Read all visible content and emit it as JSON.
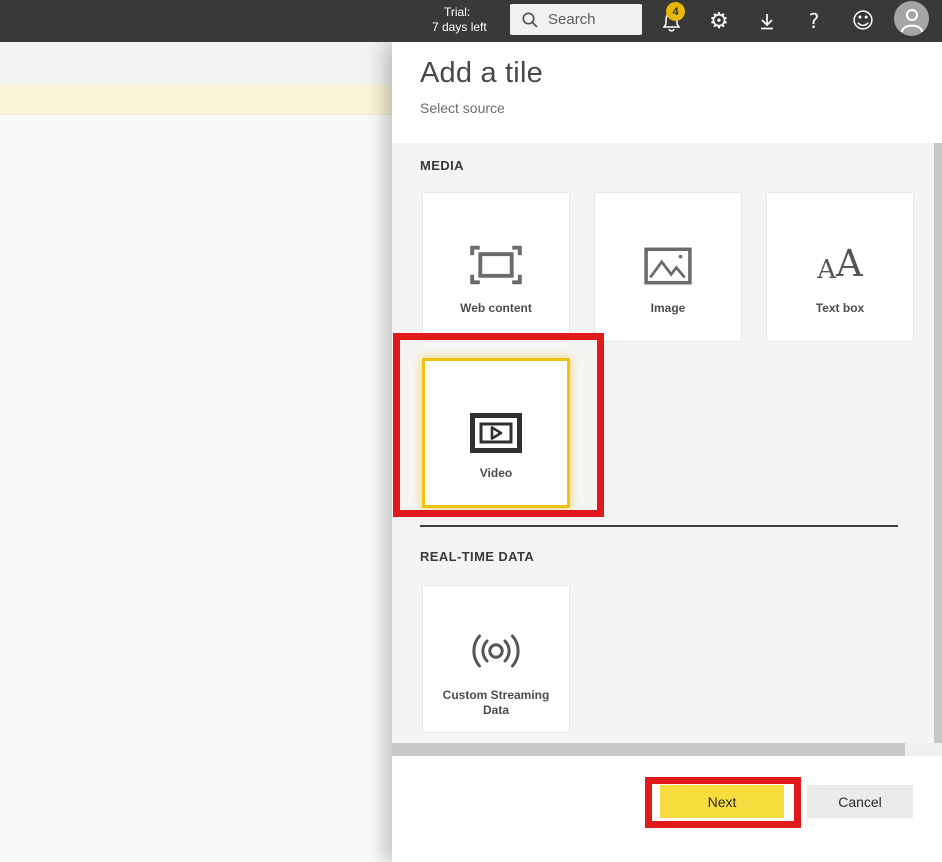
{
  "colors": {
    "topbar_bg": "#393937",
    "accent_yellow": "#F7DC3D",
    "selection_yellow": "#EFC310",
    "badge_yellow": "#E7B60B",
    "annotation_red": "#E0191A"
  },
  "topbar": {
    "trial_label": "Trial:",
    "trial_value": "7 days left",
    "search": {
      "placeholder": "Search"
    },
    "notifications": {
      "count": "4"
    },
    "glyphs": {
      "gear": "⚙",
      "help": "?",
      "smiley": "☺"
    }
  },
  "panel": {
    "title": "Add a tile",
    "subtitle": "Select source",
    "sections": [
      {
        "label": "MEDIA",
        "tiles": [
          {
            "label": "Web content",
            "icon": "web-content-icon",
            "selected": false
          },
          {
            "label": "Image",
            "icon": "image-icon",
            "selected": false
          },
          {
            "label": "Text box",
            "icon": "text-box-icon",
            "selected": false
          },
          {
            "label": "Video",
            "icon": "video-icon",
            "selected": true
          }
        ]
      },
      {
        "label": "REAL-TIME DATA",
        "tiles": [
          {
            "label": "Custom Streaming Data",
            "icon": "streaming-icon",
            "selected": false
          }
        ]
      }
    ],
    "textbox_glyphs": {
      "small": "A",
      "large": "A"
    },
    "footer": {
      "next_label": "Next",
      "cancel_label": "Cancel"
    }
  }
}
